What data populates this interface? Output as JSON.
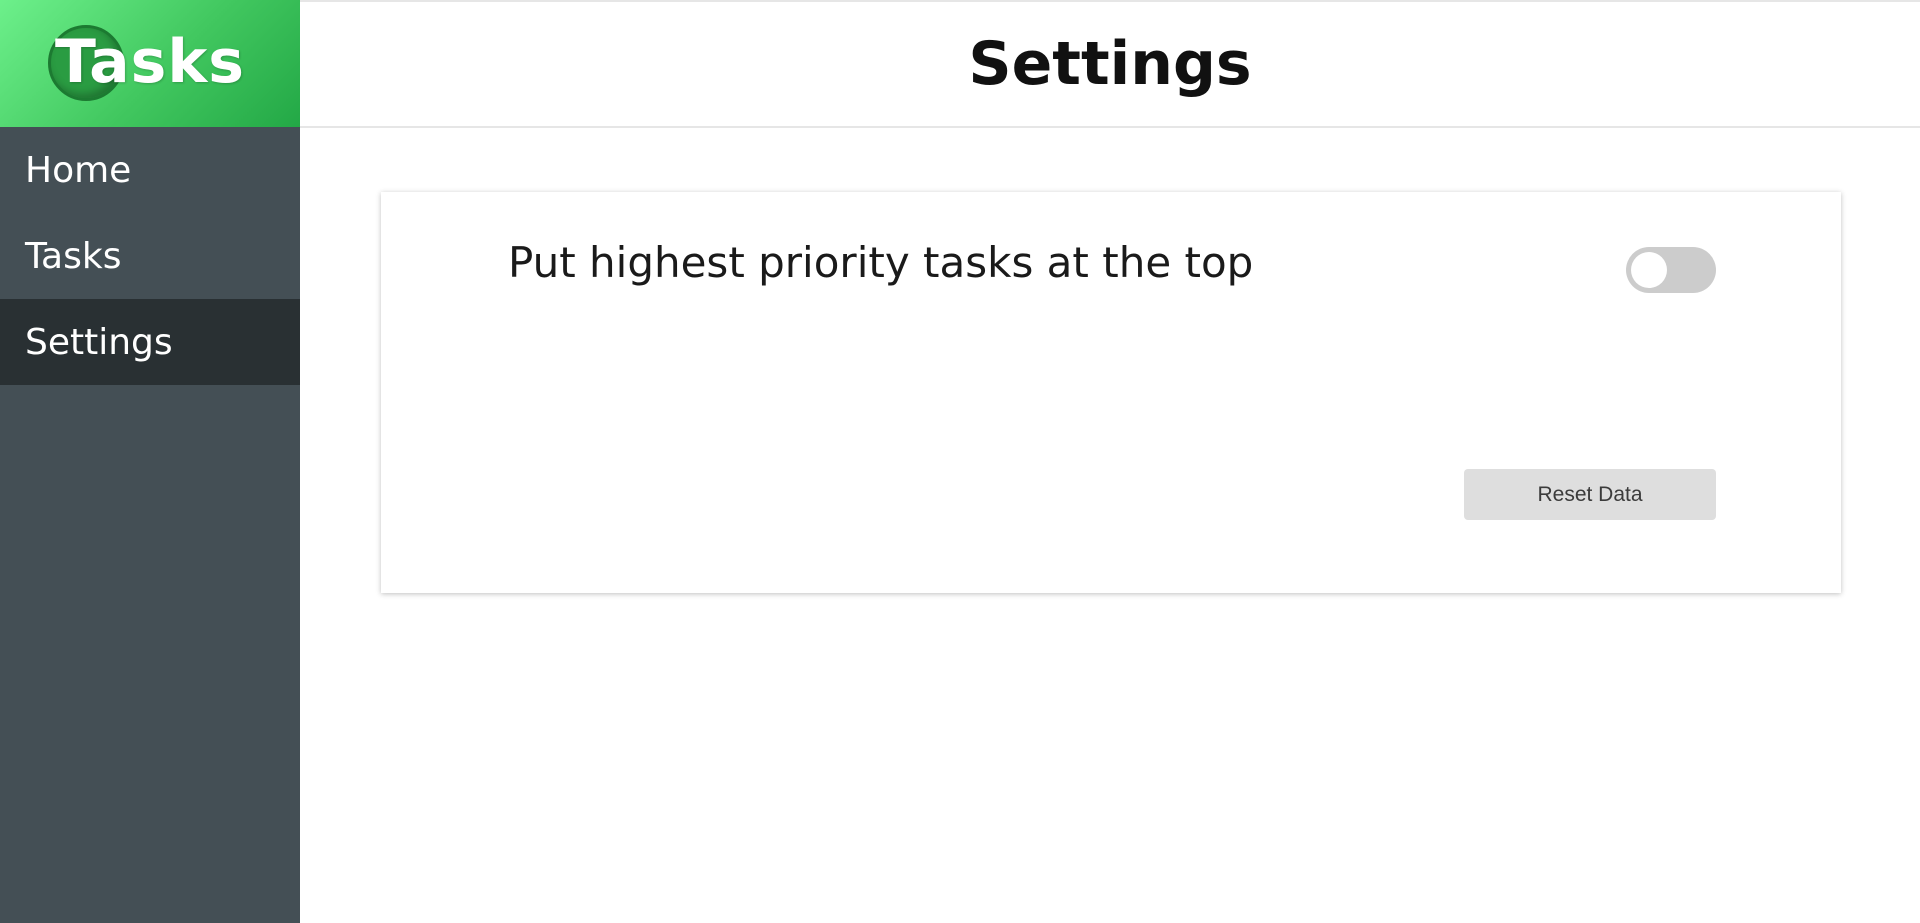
{
  "app": {
    "logo_text": "Tasks"
  },
  "sidebar": {
    "items": [
      {
        "label": "Home",
        "active": false
      },
      {
        "label": "Tasks",
        "active": false
      },
      {
        "label": "Settings",
        "active": true
      }
    ]
  },
  "header": {
    "title": "Settings"
  },
  "settings": {
    "priority_toggle": {
      "label": "Put highest priority tasks at the top",
      "enabled": false
    },
    "reset_button_label": "Reset Data"
  },
  "colors": {
    "sidebar": "#444f55",
    "sidebar_active": "#293033",
    "logo_gradient_start": "#6df08b",
    "logo_gradient_end": "#23a846",
    "toggle_off": "#cccccc",
    "button_bg": "#dedede"
  },
  "icons": {
    "logo": "logo-icon"
  }
}
